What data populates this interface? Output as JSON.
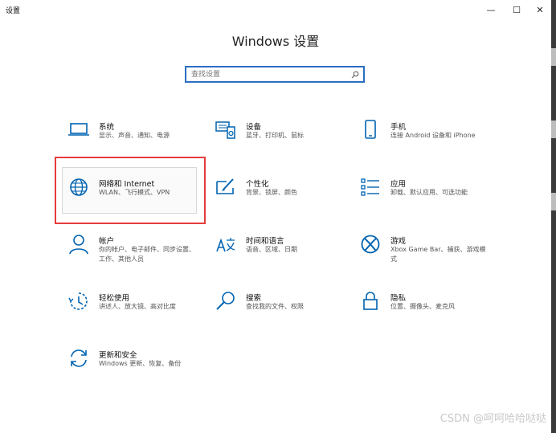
{
  "window": {
    "title": "设置",
    "minimize": "—",
    "maximize": "☐",
    "close": "✕"
  },
  "heading": "Windows 设置",
  "search": {
    "placeholder": "查找设置"
  },
  "categories": [
    {
      "title": "系统",
      "desc": "显示、声音、通知、电源",
      "icon": "monitor-icon"
    },
    {
      "title": "设备",
      "desc": "蓝牙、打印机、鼠标",
      "icon": "devices-icon"
    },
    {
      "title": "手机",
      "desc": "连接 Android 设备和 iPhone",
      "icon": "phone-icon"
    },
    {
      "title": "网络和 Internet",
      "desc": "WLAN、飞行模式、VPN",
      "icon": "globe-icon"
    },
    {
      "title": "个性化",
      "desc": "背景、锁屏、颜色",
      "icon": "personalization-icon"
    },
    {
      "title": "应用",
      "desc": "卸载、默认应用、可选功能",
      "icon": "apps-list-icon"
    },
    {
      "title": "帐户",
      "desc": "你的帐户、电子邮件、同步设置、工作、其他人员",
      "icon": "person-icon"
    },
    {
      "title": "时间和语言",
      "desc": "语音、区域、日期",
      "icon": "time-language-icon"
    },
    {
      "title": "游戏",
      "desc": "Xbox Game Bar、捕获、游戏模式",
      "icon": "xbox-icon"
    },
    {
      "title": "轻松使用",
      "desc": "讲述人、放大镜、高对比度",
      "icon": "ease-of-access-icon"
    },
    {
      "title": "搜索",
      "desc": "查找我的文件、权限",
      "icon": "search-icon"
    },
    {
      "title": "隐私",
      "desc": "位置、摄像头、麦克风",
      "icon": "lock-icon"
    },
    {
      "title": "更新和安全",
      "desc": "Windows 更新、恢复、备份",
      "icon": "update-icon"
    }
  ],
  "watermark": "CSDN @呵呵哈哈哒哒",
  "colors": {
    "accent": "#0078d7",
    "highlight": "#e53b3b"
  }
}
